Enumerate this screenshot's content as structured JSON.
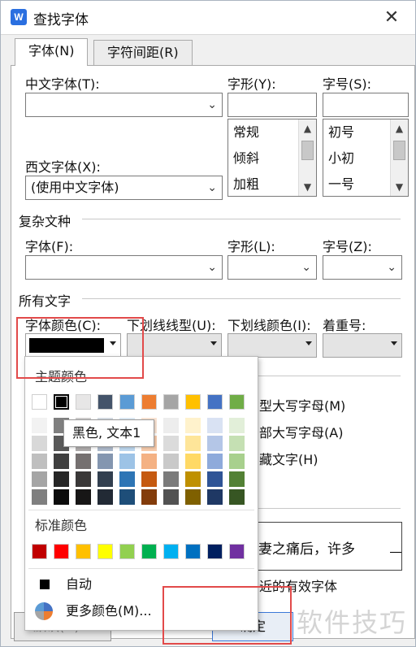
{
  "window": {
    "title": "查找字体",
    "logo": "W"
  },
  "tabs": [
    {
      "label": "字体(N)"
    },
    {
      "label": "字符间距(R)"
    }
  ],
  "font_section": {
    "chinese_font_label": "中文字体(T):",
    "chinese_font_value": "",
    "western_font_label": "西文字体(X):",
    "western_font_value": "(使用中文字体)",
    "style_label": "字形(Y):",
    "style_items": [
      "常规",
      "倾斜",
      "加粗"
    ],
    "size_label": "字号(S):",
    "size_items": [
      "初号",
      "小初",
      "一号"
    ]
  },
  "complex_section": {
    "heading": "复杂文种",
    "font_label": "字体(F):",
    "style_label": "字形(L):",
    "size_label": "字号(Z):"
  },
  "all_text_section": {
    "heading": "所有文字",
    "color_label": "字体颜色(C):",
    "underline_label": "下划线线型(U):",
    "underline_color_label": "下划线颜色(I):",
    "emphasis_label": "着重号:"
  },
  "effects": {
    "small_caps": "型大写字母(M)",
    "all_caps": "部大写字母(A)",
    "hidden": "藏文字(H)"
  },
  "preview_text": "妻之痛后，许多",
  "preview_note": "近的有效字体",
  "color_popup": {
    "theme_label": "主题颜色",
    "standard_label": "标准颜色",
    "auto_label": "自动",
    "more_label": "更多颜色(M)...",
    "tooltip": "黑色, 文本1",
    "theme_colors": [
      "#ffffff",
      "#000000",
      "#e7e6e6",
      "#44546a",
      "#5b9bd5",
      "#ed7d31",
      "#a5a5a5",
      "#ffc000",
      "#4472c4",
      "#70ad47"
    ],
    "theme_shades": [
      [
        "#f2f2f2",
        "#7f7f7f",
        "#d0cece",
        "#d6dce4",
        "#deebf6",
        "#fbe5d5",
        "#ededed",
        "#fff2cc",
        "#d9e2f3",
        "#e2efd9"
      ],
      [
        "#d8d8d8",
        "#595959",
        "#aeabab",
        "#adb9ca",
        "#bdd7ee",
        "#f7cbac",
        "#dbdbdb",
        "#fee599",
        "#b4c6e7",
        "#c5e0b3"
      ],
      [
        "#bfbfbf",
        "#3f3f3f",
        "#757070",
        "#8496b0",
        "#9dc3e6",
        "#f4b183",
        "#c9c9c9",
        "#ffd965",
        "#8eaadb",
        "#a8d08d"
      ],
      [
        "#a5a5a5",
        "#262626",
        "#3a3838",
        "#323f4f",
        "#2e75b5",
        "#c55a11",
        "#7b7b7b",
        "#bf9000",
        "#2f5496",
        "#538135"
      ],
      [
        "#7f7f7f",
        "#0c0c0c",
        "#171616",
        "#222a35",
        "#1e4e79",
        "#833c0b",
        "#525252",
        "#7f6000",
        "#1f3864",
        "#375623"
      ]
    ],
    "standard_colors": [
      "#c00000",
      "#ff0000",
      "#ffc000",
      "#ffff00",
      "#92d050",
      "#00b050",
      "#00b0f0",
      "#0070c0",
      "#002060",
      "#7030a0"
    ],
    "selected_color": "#000000",
    "auto_color": "#000000"
  },
  "buttons": {
    "default": "默认(D)...",
    "ok": "确定"
  },
  "watermark": "软件技巧"
}
